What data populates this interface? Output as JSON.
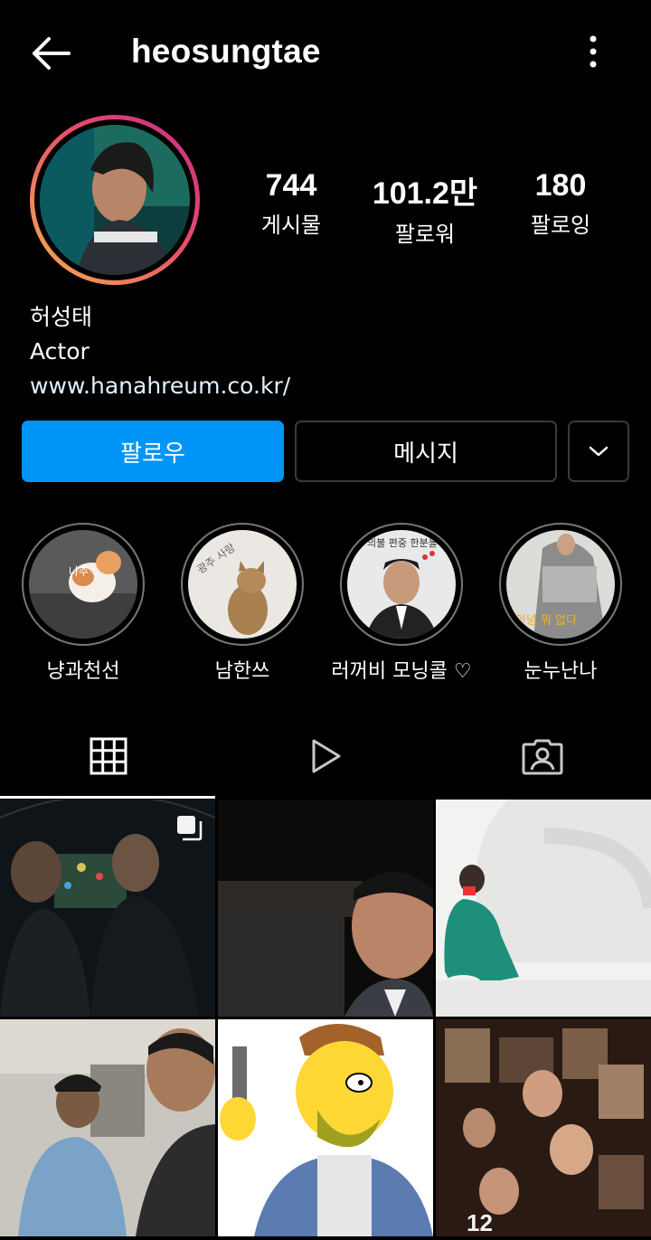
{
  "header": {
    "username": "heosungtae",
    "back_icon": "arrow-left-icon",
    "more_icon": "more-vertical-icon"
  },
  "stats": [
    {
      "value": "744",
      "label": "게시물"
    },
    {
      "value": "101.2만",
      "label": "팔로워"
    },
    {
      "value": "180",
      "label": "팔로잉"
    }
  ],
  "bio": {
    "name": "허성태",
    "category": "Actor",
    "link": "www.hanahreum.co.kr/"
  },
  "actions": {
    "follow": "팔로우",
    "message": "메시지",
    "dropdown_icon": "chevron-down-icon"
  },
  "highlights": [
    {
      "label": "냥과천선",
      "overlay": "나주♡"
    },
    {
      "label": "남한쓰",
      "overlay": "광주 사랑"
    },
    {
      "label": "러꺼비 모닝콜 ♡",
      "overlay": "의불 편중 한분을"
    },
    {
      "label": "눈누난나",
      "overlay": "안녕 뭐 없다"
    }
  ],
  "tabs": [
    {
      "name": "grid",
      "icon": "grid-icon"
    },
    {
      "name": "reels",
      "icon": "play-icon"
    },
    {
      "name": "tagged",
      "icon": "tagged-user-icon"
    }
  ],
  "posts": [
    {
      "alt": "two men under umbrella at night",
      "multi": true
    },
    {
      "alt": "man in car selfie at night",
      "multi": false
    },
    {
      "alt": "person in green tracksuit sitting",
      "multi": false
    },
    {
      "alt": "two men in a car",
      "multi": false
    },
    {
      "alt": "cartoon character with phone",
      "multi": false
    },
    {
      "alt": "movie poster collage",
      "multi": false,
      "caption": "12"
    }
  ],
  "colors": {
    "accent": "#0095f6",
    "background": "#000000",
    "border": "#3a3a3a"
  }
}
